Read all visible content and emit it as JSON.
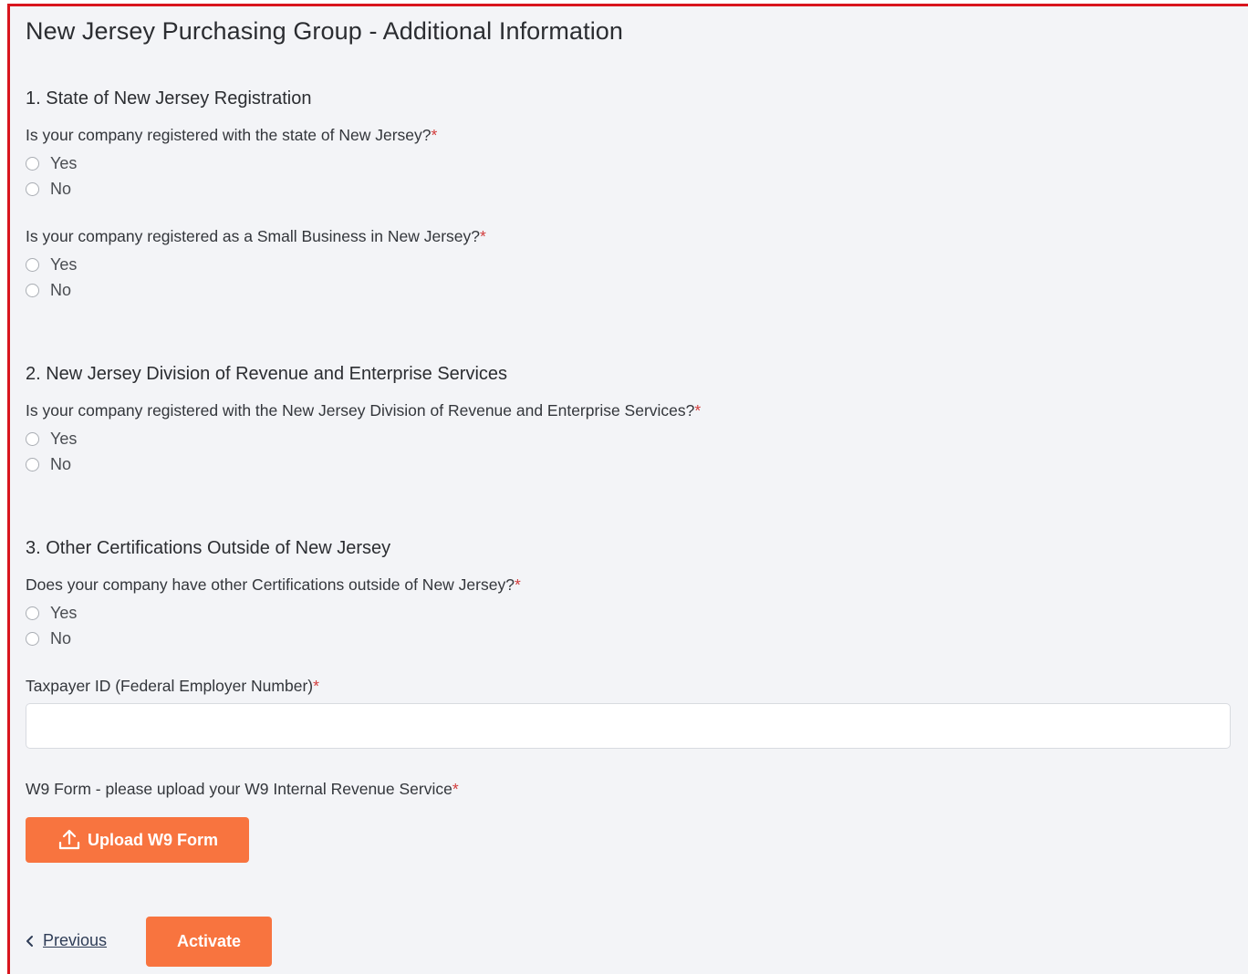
{
  "page": {
    "title": "New Jersey Purchasing Group - Additional Information"
  },
  "sections": [
    {
      "title": "1. State of New Jersey Registration",
      "questions": [
        {
          "text": "Is your company registered with the state of New Jersey?",
          "required": "*",
          "options": [
            "Yes",
            "No"
          ]
        },
        {
          "text": "Is your company registered as a Small Business in New Jersey?",
          "required": "*",
          "options": [
            "Yes",
            "No"
          ]
        }
      ]
    },
    {
      "title": "2. New Jersey Division of Revenue and Enterprise Services",
      "questions": [
        {
          "text": "Is your company registered with the New Jersey Division of Revenue and Enterprise Services?",
          "required": "*",
          "options": [
            "Yes",
            "No"
          ]
        }
      ]
    },
    {
      "title": "3. Other Certifications Outside of New Jersey",
      "questions": [
        {
          "text": "Does your company have other Certifications outside of New Jersey?",
          "required": "*",
          "options": [
            "Yes",
            "No"
          ]
        }
      ]
    }
  ],
  "taxpayer": {
    "label": "Taxpayer ID (Federal Employer Number)",
    "required": "*",
    "value": ""
  },
  "w9": {
    "label": "W9 Form - please upload your W9 Internal Revenue Service",
    "required": "*",
    "button_label": "Upload W9 Form",
    "button_icon": "upload-icon"
  },
  "navigation": {
    "previous_label": "Previous",
    "previous_icon": "chevron-left-icon",
    "activate_label": "Activate"
  },
  "colors": {
    "accent": "#f8743f",
    "required": "#d23c3c",
    "frame_border": "#d9161e",
    "background": "#f3f4f7"
  }
}
